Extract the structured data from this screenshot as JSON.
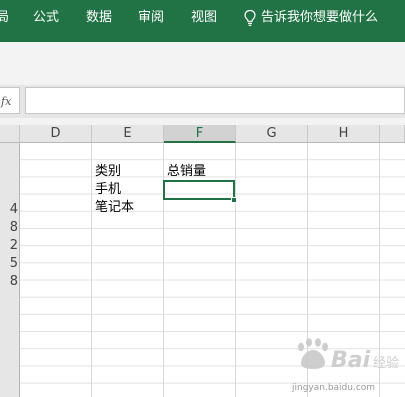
{
  "ribbon": {
    "tabs": [
      {
        "label": "局"
      },
      {
        "label": "公式"
      },
      {
        "label": "数据"
      },
      {
        "label": "审阅"
      },
      {
        "label": "视图"
      }
    ],
    "tell_me": "告诉我你想要做什么",
    "tell_me_icon": "lightbulb-icon",
    "background_color": "#217346"
  },
  "formula_bar": {
    "fx_label": "fx",
    "value": ""
  },
  "sheet": {
    "columns": [
      "D",
      "E",
      "F",
      "G",
      "H"
    ],
    "selected_column": "F",
    "row_numbers": [
      "4",
      "8",
      "2",
      "5",
      "8"
    ],
    "cells": {
      "e_header": "类别",
      "f_header": "总销量",
      "e_row1": "手机",
      "e_row2": "笔记本"
    },
    "active_cell": {
      "column": "F",
      "value": ""
    }
  },
  "watermark": {
    "text": "Bai 经验",
    "sub": "jingyan.baidu.com"
  }
}
